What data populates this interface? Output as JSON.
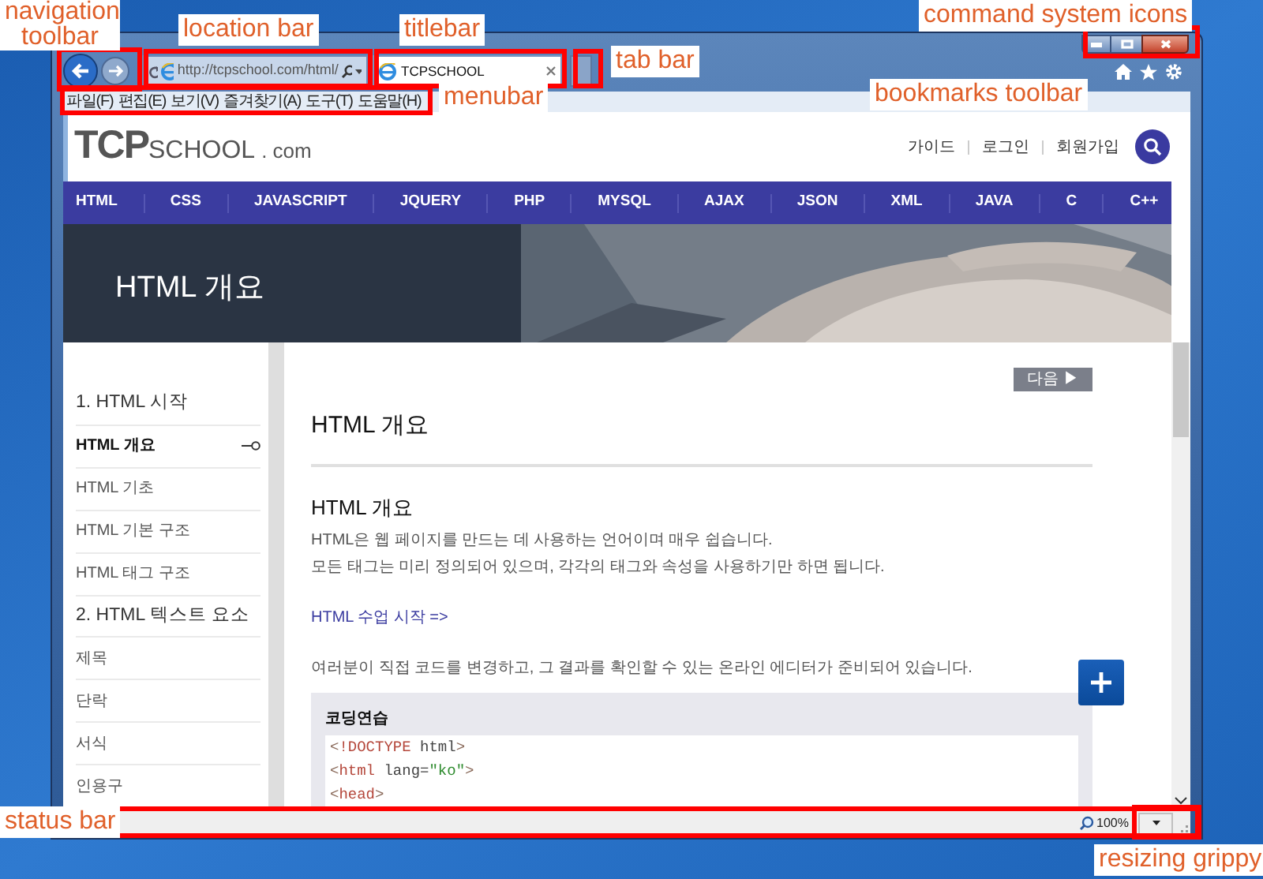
{
  "annotations": [
    {
      "label": "navigation toolbar"
    },
    {
      "label": "location bar"
    },
    {
      "label": "titlebar"
    },
    {
      "label": "tab bar"
    },
    {
      "label": "menubar"
    },
    {
      "label": "command system icons"
    },
    {
      "label": "bookmarks toolbar"
    },
    {
      "label": "status bar"
    },
    {
      "label": "resizing grippy"
    }
  ],
  "browser": {
    "address": "http://tcpschool.com/html/",
    "tabs": [
      {
        "title": "TCPSCHOOL",
        "selected": true
      }
    ],
    "menu": [
      "파일(F)",
      "편집(E)",
      "보기(V)",
      "즐겨찾기(A)",
      "도구(T)",
      "도움말(H)"
    ],
    "zoom": "100%"
  },
  "site": {
    "logo": [
      "TCP",
      "SCHOOL",
      ". com"
    ],
    "header_links": [
      "가이드",
      "로그인",
      "회원가입"
    ],
    "nav": [
      "HTML",
      "CSS",
      "JAVASCRIPT",
      "JQUERY",
      "PHP",
      "MYSQL",
      "AJAX",
      "JSON",
      "XML",
      "JAVA",
      "C",
      "C++"
    ],
    "hero_title": "HTML 개요",
    "sidebar": [
      {
        "label": "1. HTML 시작",
        "kind": "section",
        "selected": false
      },
      {
        "label": "HTML 개요",
        "kind": "item",
        "selected": true
      },
      {
        "label": "HTML 기초",
        "kind": "item",
        "selected": false
      },
      {
        "label": "HTML 기본 구조",
        "kind": "item",
        "selected": false
      },
      {
        "label": "HTML 태그 구조",
        "kind": "item",
        "selected": false
      },
      {
        "label": "2. HTML 텍스트 요소",
        "kind": "section",
        "selected": false
      },
      {
        "label": "제목",
        "kind": "item",
        "selected": false
      },
      {
        "label": "단락",
        "kind": "item",
        "selected": false
      },
      {
        "label": "서식",
        "kind": "item",
        "selected": false
      },
      {
        "label": "인용구",
        "kind": "item",
        "selected": false
      }
    ],
    "next_button": "다음 ▶",
    "page_title": "HTML 개요",
    "section_title": "HTML 개요",
    "paragraphs": [
      "HTML은 웹 페이지를 만드는 데 사용하는 언어이며 매우 쉽습니다.",
      "모든 태그는 미리 정의되어 있으며, 각각의 태그와 속성을 사용하기만 하면 됩니다."
    ],
    "link": "HTML 수업 시작 =>",
    "editor_note": "여러분이 직접 코드를 변경하고, 그 결과를 확인할 수 있는 온라인 에디터가 준비되어 있습니다.",
    "practice": {
      "title": "코딩연습",
      "code": [
        [
          {
            "text": "<",
            "kind": "punct"
          },
          {
            "text": "!DOCTYPE",
            "kind": "tag"
          },
          {
            "text": " html",
            "kind": "attr"
          },
          {
            "text": ">",
            "kind": "punct"
          }
        ],
        [
          {
            "text": "<",
            "kind": "punct"
          },
          {
            "text": "html",
            "kind": "tag"
          },
          {
            "text": " lang=",
            "kind": "attr"
          },
          {
            "text": "\"ko\"",
            "kind": "value"
          },
          {
            "text": ">",
            "kind": "punct"
          }
        ],
        [
          {
            "text": "<",
            "kind": "punct"
          },
          {
            "text": "head",
            "kind": "tag"
          },
          {
            "text": ">",
            "kind": "punct"
          }
        ]
      ]
    }
  }
}
